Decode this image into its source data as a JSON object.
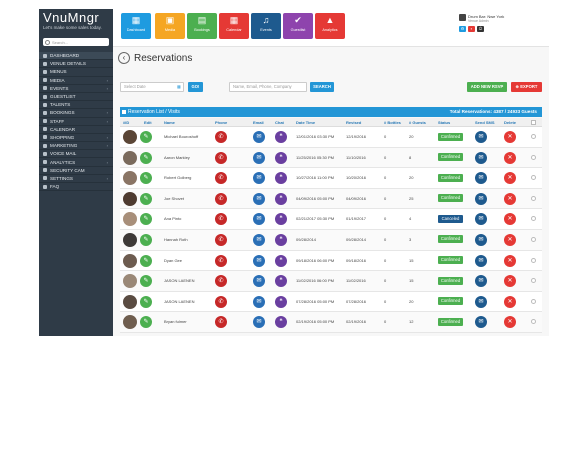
{
  "brand": {
    "name": "VnuMngr",
    "tagline": "Let's make some sales today."
  },
  "search": {
    "placeholder": "Search..."
  },
  "sidebar": {
    "items": [
      {
        "label": "DASHBOARD",
        "has_submenu": false
      },
      {
        "label": "VENUE DETAILS",
        "has_submenu": false
      },
      {
        "label": "MENUS",
        "has_submenu": false
      },
      {
        "label": "MEDIA",
        "has_submenu": true
      },
      {
        "label": "EVENTS",
        "has_submenu": true
      },
      {
        "label": "GUESTLIST",
        "has_submenu": false
      },
      {
        "label": "TALENTS",
        "has_submenu": false
      },
      {
        "label": "BOOKINGS",
        "has_submenu": true
      },
      {
        "label": "STAFF",
        "has_submenu": true
      },
      {
        "label": "CALENDAR",
        "has_submenu": false
      },
      {
        "label": "SHOPPING",
        "has_submenu": true
      },
      {
        "label": "MARKETING",
        "has_submenu": true
      },
      {
        "label": "VOICE MAIL",
        "has_submenu": false
      },
      {
        "label": "ANALYTICS",
        "has_submenu": true
      },
      {
        "label": "SECURITY CAM",
        "has_submenu": false
      },
      {
        "label": "SETTINGS",
        "has_submenu": true
      },
      {
        "label": "FAQ",
        "has_submenu": false
      }
    ]
  },
  "topnav": {
    "tiles": [
      {
        "label": "Dashboard",
        "icon": "grid-icon",
        "glyph": "▦",
        "color": "#1e9be0"
      },
      {
        "label": "Media",
        "icon": "image-icon",
        "glyph": "▣",
        "color": "#f5a623"
      },
      {
        "label": "Bookings",
        "icon": "book-icon",
        "glyph": "▤",
        "color": "#4caf50"
      },
      {
        "label": "Calendar",
        "icon": "calendar-icon",
        "glyph": "▦",
        "color": "#e53935"
      },
      {
        "label": "Events",
        "icon": "music-icon",
        "glyph": "♫",
        "color": "#1e5a8e"
      },
      {
        "label": "Guestlist",
        "icon": "check-icon",
        "glyph": "✔",
        "color": "#8e44ad"
      },
      {
        "label": "Analytics",
        "icon": "chart-icon",
        "glyph": "▲",
        "color": "#e53935"
      }
    ]
  },
  "user": {
    "name": "Drum Bar: Nwe York",
    "role": "Venue Admin"
  },
  "page": {
    "title": "Reservations"
  },
  "filters": {
    "date_placeholder": "Select Date",
    "go_label": "GO!",
    "search_placeholder": "Name, Email, Phone, Company",
    "search_label": "SEARCH",
    "add_label": "ADD NEW RSVP",
    "export_label": "⊕ EXPORT"
  },
  "list": {
    "title": "Reservation List / Visits",
    "totals": "Total Reservations: 4387 / 24933 Guests",
    "columns": [
      "#ID",
      "Edit",
      "Name",
      "Phone",
      "Email",
      "Chat",
      "Date Time",
      "Revised",
      "# Bottles",
      "# Guests",
      "Status",
      "Send SMS",
      "Delete"
    ],
    "rows": [
      {
        "name": "Michael Bouroshoff",
        "date_time": "12/01/2016 03:30 PM",
        "revised": "12/19/2016",
        "bottles": "0",
        "guests": "20",
        "status": "Confirmed",
        "status_color": "#4caf50"
      },
      {
        "name": "Aaron Markley",
        "date_time": "11/25/2016 05:30 PM",
        "revised": "11/10/2016",
        "bottles": "0",
        "guests": "8",
        "status": "Confirmed",
        "status_color": "#4caf50"
      },
      {
        "name": "Robert Golberg",
        "date_time": "10/27/2016 11:00 PM",
        "revised": "10/20/2016",
        "bottles": "0",
        "guests": "20",
        "status": "Confirmed",
        "status_color": "#4caf50"
      },
      {
        "name": "Joe Shovet",
        "date_time": "04/09/2016 05:00 PM",
        "revised": "04/09/2016",
        "bottles": "0",
        "guests": "25",
        "status": "Confirmed",
        "status_color": "#4caf50"
      },
      {
        "name": "Ana Pinto",
        "date_time": "02/21/2017 05:30 PM",
        "revised": "01/19/2017",
        "bottles": "0",
        "guests": "4",
        "status": "Canceled",
        "status_color": "#1e5a8e"
      },
      {
        "name": "Hannah Roth",
        "date_time": "09/28/2014",
        "revised": "09/28/2014",
        "bottles": "0",
        "guests": "3",
        "status": "Confirmed",
        "status_color": "#4caf50"
      },
      {
        "name": "Dyan Gee",
        "date_time": "09/18/2016 06:00 PM",
        "revised": "09/18/2016",
        "bottles": "0",
        "guests": "15",
        "status": "Confirmed",
        "status_color": "#4caf50"
      },
      {
        "name": "JASON LAENEN",
        "date_time": "11/02/2016 06:00 PM",
        "revised": "11/02/2016",
        "bottles": "0",
        "guests": "15",
        "status": "Confirmed",
        "status_color": "#4caf50"
      },
      {
        "name": "JASON LAENEN",
        "date_time": "07/28/2016 05:00 PM",
        "revised": "07/28/2016",
        "bottles": "0",
        "guests": "20",
        "status": "Confirmed",
        "status_color": "#4caf50"
      },
      {
        "name": "Bryan fulmer",
        "date_time": "02/19/2016 05:00 PM",
        "revised": "02/19/2016",
        "bottles": "0",
        "guests": "12",
        "status": "Confirmed",
        "status_color": "#4caf50"
      }
    ]
  }
}
